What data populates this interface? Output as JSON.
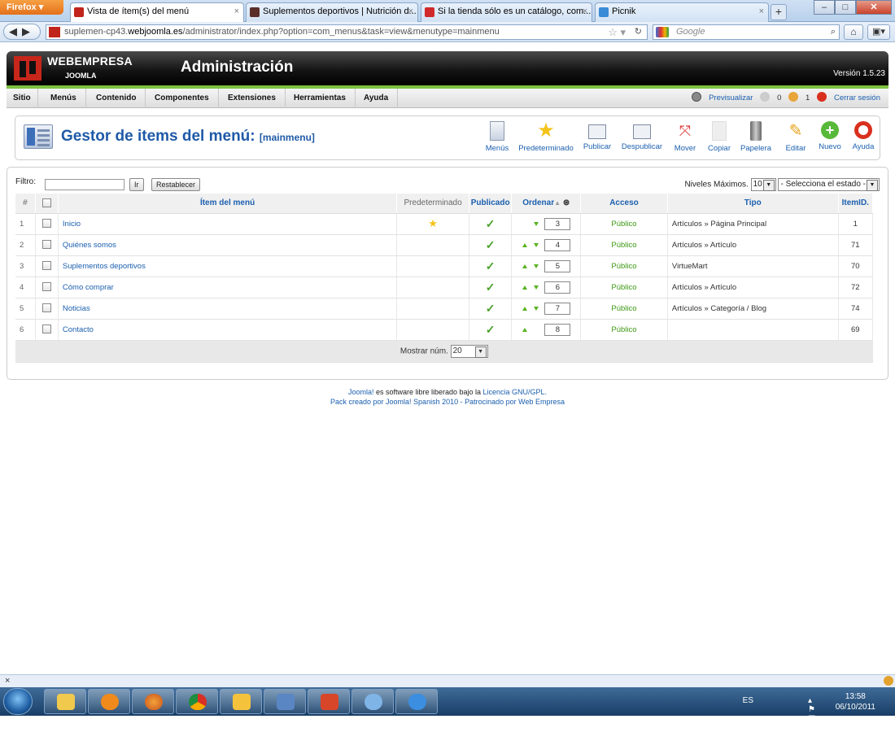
{
  "browser": {
    "firefox_label": "Firefox",
    "tabs": [
      {
        "title": "Vista de ítem(s) del menú",
        "fav": "#c0241a"
      },
      {
        "title": "Suplementos deportivos | Nutrición d...",
        "fav": "#5a2f2a"
      },
      {
        "title": "Si la tienda sólo es un catálogo, com...",
        "fav": "#d12a2a"
      },
      {
        "title": "Picnik",
        "fav": "#3a8bd6"
      }
    ],
    "close_glyph": "×",
    "newtab_glyph": "+",
    "url_prefix": "suplemen-cp43.",
    "url_domain": "webjoomla.es",
    "url_rest": "/administrator/index.php?option=com_menus&task=view&menutype=mainmenu",
    "search_placeholder": "Google"
  },
  "joomla": {
    "logo_text": "WEBEMPRESA",
    "logo_sub": "JOOMLA",
    "title": "Administración",
    "version": "Versión 1.5.23",
    "menu": [
      "Sitio",
      "Menús",
      "Contenido",
      "Componentes",
      "Extensiones",
      "Herramientas",
      "Ayuda"
    ],
    "status": {
      "preview": "Previsualizar",
      "messages": "0",
      "users": "1",
      "logout": "Cerrar sesión"
    }
  },
  "page": {
    "title": "Gestor de items del menú:",
    "title_suffix": "[mainmenu]",
    "toolbar": [
      {
        "label": "Menús",
        "icon": "menus-icon"
      },
      {
        "label": "Predeterminado",
        "icon": "star-icon"
      },
      {
        "label": "Publicar",
        "icon": "publish-icon"
      },
      {
        "label": "Despublicar",
        "icon": "unpublish-icon"
      },
      {
        "label": "Mover",
        "icon": "move-icon"
      },
      {
        "label": "Copiar",
        "icon": "copy-icon"
      },
      {
        "label": "Papelera",
        "icon": "trash-icon"
      },
      {
        "label": "Editar",
        "icon": "edit-icon"
      },
      {
        "label": "Nuevo",
        "icon": "new-icon"
      },
      {
        "label": "Ayuda",
        "icon": "help-icon"
      }
    ]
  },
  "filter": {
    "label": "Filtro:",
    "value": "",
    "go": "Ir",
    "reset": "Restablecer",
    "levels_label": "Niveles Máximos.",
    "levels_value": "10",
    "state_value": "- Selecciona el estado -"
  },
  "table": {
    "headers": {
      "num": "#",
      "item": "Ítem del menú",
      "default": "Predeterminado",
      "published": "Publicado",
      "order": "Ordenar",
      "access": "Acceso",
      "type": "Tipo",
      "itemid": "ItemID."
    },
    "rows": [
      {
        "num": "1",
        "name": "Inicio",
        "default": true,
        "published": true,
        "up": false,
        "down": true,
        "order": "3",
        "access": "Público",
        "type": "Artículos » Página Principal",
        "id": "1"
      },
      {
        "num": "2",
        "name": "Quiénes somos",
        "default": false,
        "published": true,
        "up": true,
        "down": true,
        "order": "4",
        "access": "Público",
        "type": "Artículos » Artículo",
        "id": "71"
      },
      {
        "num": "3",
        "name": "Suplementos deportivos",
        "default": false,
        "published": true,
        "up": true,
        "down": true,
        "order": "5",
        "access": "Público",
        "type": "VirtueMart",
        "id": "70"
      },
      {
        "num": "4",
        "name": "Cómo comprar",
        "default": false,
        "published": true,
        "up": true,
        "down": true,
        "order": "6",
        "access": "Público",
        "type": "Artículos » Artículo",
        "id": "72"
      },
      {
        "num": "5",
        "name": "Noticias",
        "default": false,
        "published": true,
        "up": true,
        "down": true,
        "order": "7",
        "access": "Público",
        "type": "Artículos » Categoría / Blog",
        "id": "74"
      },
      {
        "num": "6",
        "name": "Contacto",
        "default": false,
        "published": true,
        "up": true,
        "down": false,
        "order": "8",
        "access": "Público",
        "type": "",
        "id": "69"
      }
    ],
    "footer_label": "Mostrar núm.",
    "footer_value": "20"
  },
  "footer": {
    "line1_link1": "Joomla!",
    "line1_text": " es software libre liberado bajo la ",
    "line1_link2": "Licencia GNU/GPL.",
    "line2": "Pack creado por Joomla! Spanish 2010 - Patrocinado por Web Empresa"
  },
  "statusbar": {
    "close": "×"
  },
  "taskbar": {
    "lang": "ES",
    "time": "13:58",
    "date": "06/10/2011"
  }
}
